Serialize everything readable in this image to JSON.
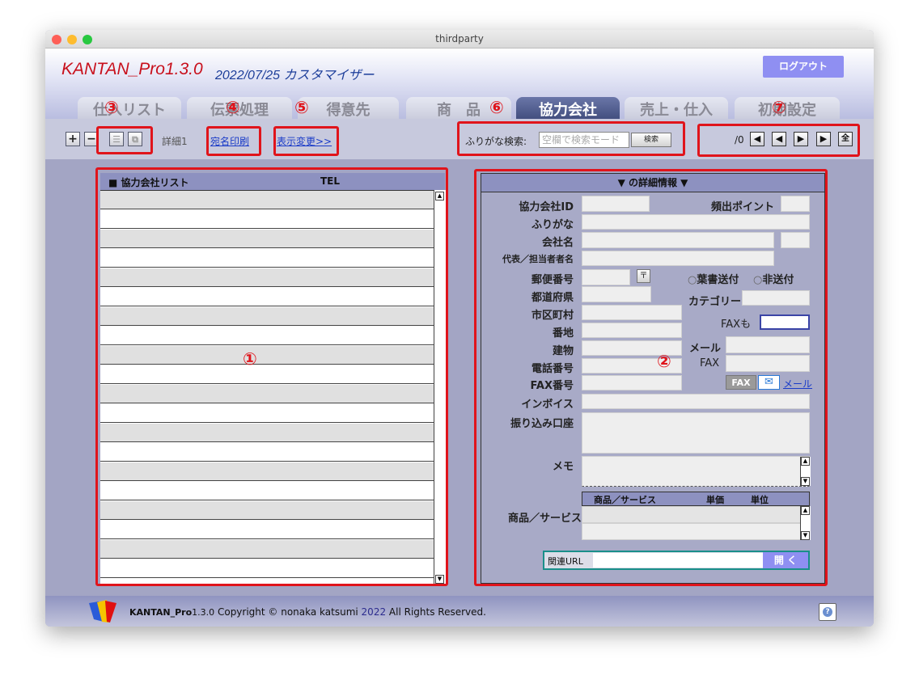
{
  "window": {
    "title": "thirdparty"
  },
  "header": {
    "app_name": "KANTAN_Pro1.3.0",
    "date_label": "2022/07/25 カスタマイザー",
    "logout_label": "ログアウト"
  },
  "tabs": [
    {
      "label": "仕入リスト"
    },
    {
      "label": "伝票処理"
    },
    {
      "label": "得意先"
    },
    {
      "label": "商　品"
    },
    {
      "label": "協力会社"
    },
    {
      "label": "売上・仕入"
    },
    {
      "label": "初期設定"
    }
  ],
  "toolbar": {
    "add_label": "+",
    "remove_label": "−",
    "list_label": "☰",
    "copy_label": "⧉",
    "detail_label": "詳細1",
    "address_print_label": "宛名印刷",
    "display_change_label": "表示変更>>",
    "search_label": "ふりがな検索:",
    "search_placeholder": "空欄で検索モード",
    "search_button": "検索",
    "record_count": "/0",
    "nav_all": "全"
  },
  "markers": {
    "m1": "①",
    "m2": "②",
    "m3": "③",
    "m4": "④",
    "m5": "⑤",
    "m6": "⑥",
    "m7": "⑦"
  },
  "list": {
    "title": "■ 協力会社リスト",
    "tel_header": "TEL"
  },
  "detail": {
    "title": "▼ の詳細情報 ▼",
    "company_id": "協力会社ID",
    "freq_point": "頻出ポイント",
    "furigana": "ふりがな",
    "company_name": "会社名",
    "representative": "代表／担当者者名",
    "postal_code": "郵便番号",
    "postal_icon": "〒",
    "radio_postcard": "葉書送付",
    "radio_nosend": "非送付",
    "prefecture": "都道府県",
    "category": "カテゴリー",
    "city": "市区町村",
    "fax_too": "FAXも",
    "address_no": "番地",
    "mail": "メール",
    "building": "建物",
    "fax": "FAX",
    "phone": "電話番号",
    "fax_number": "FAX番号",
    "fax_button": "FAX",
    "mail_link": "メール",
    "invoice": "インボイス",
    "bank": "振り込み口座",
    "memo": "メモ",
    "products_label": "商品／サービス",
    "products_table": {
      "col_product": "商品／サービス",
      "col_price": "単価",
      "col_unit": "単位"
    },
    "related_url": "関連URL",
    "open_button": "開 く"
  },
  "footer": {
    "brand": "KANTAN_Pro",
    "version": "1.3.0",
    "copyright_prefix": " Copyright © nonaka katsumi ",
    "year": "2022",
    "rights": " All Rights Reserved.",
    "help": "?"
  }
}
